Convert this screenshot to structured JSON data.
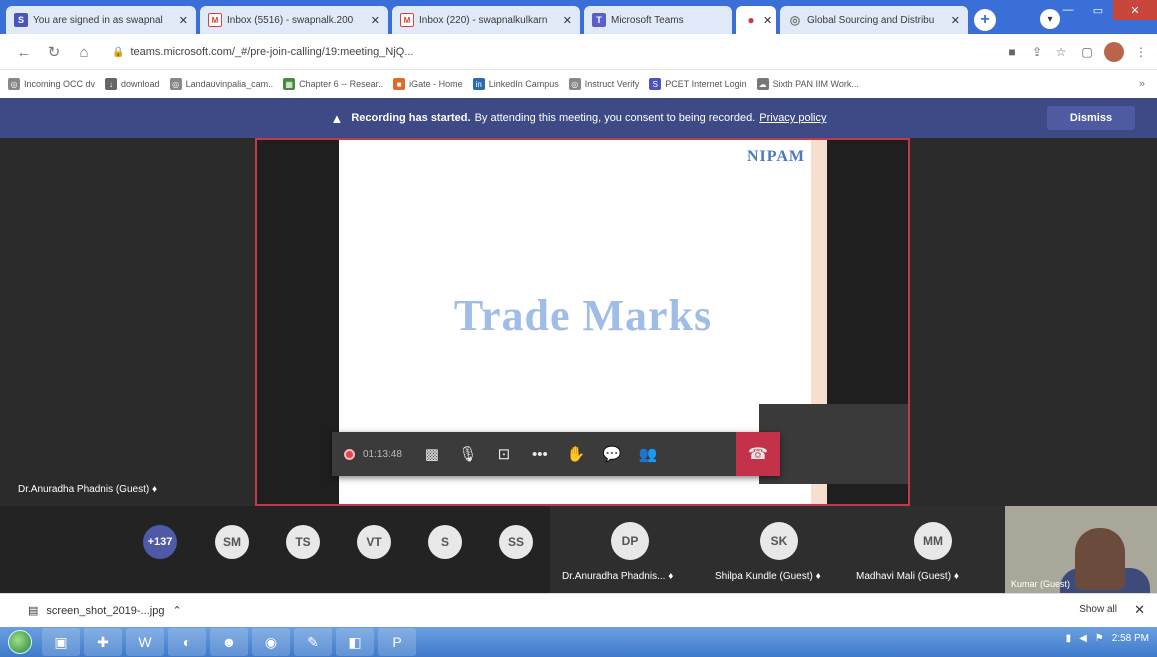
{
  "browser": {
    "tabs": [
      {
        "title": "You are signed in as swapnal",
        "favicon": "s-icon"
      },
      {
        "title": "Inbox (5516) - swapnalk.200",
        "favicon": "gmail-icon"
      },
      {
        "title": "Inbox (220) - swapnalkulkarn",
        "favicon": "gmail-icon"
      },
      {
        "title": "Microsoft Teams",
        "favicon": "teams-icon"
      },
      {
        "title": "",
        "favicon": "recording-dot-icon"
      },
      {
        "title": "Global Sourcing and Distribu",
        "favicon": "globe-icon"
      }
    ],
    "url": "teams.microsoft.com/_#/pre-join-calling/19:meeting_NjQ...",
    "bookmarks": [
      "Incoming OCC dv",
      "download",
      "Landauvinpalia_cam..",
      "Chapter 6 -- Resear..",
      "iGate - Home",
      "LinkedIn Campus",
      "Instruct Verify",
      "PCET Internet Login",
      "Sixth PAN IIM Work..."
    ],
    "bookmarks_more": "»"
  },
  "meeting": {
    "banner": {
      "bold": "Recording has started.",
      "text": "By attending this meeting, you consent to being recorded.",
      "link": "Privacy policy",
      "dismiss": "Dismiss"
    },
    "slide": {
      "logo": "NIPAM",
      "headline": "Trade Marks"
    },
    "presenter_label": "Dr.Anuradha Phadnis (Guest)",
    "timer": "01:13:48",
    "participants": [
      {
        "initials": "+137",
        "kind": "more"
      },
      {
        "initials": "SM",
        "kind": "avatar"
      },
      {
        "initials": "TS",
        "kind": "avatar"
      },
      {
        "initials": "VT",
        "kind": "avatar"
      },
      {
        "initials": "S",
        "kind": "avatar"
      },
      {
        "initials": "SS",
        "kind": "avatar"
      }
    ],
    "named_participants": [
      {
        "initials": "DP",
        "name": "Dr.Anuradha Phadnis..."
      },
      {
        "initials": "SK",
        "name": "Shilpa Kundle (Guest)"
      },
      {
        "initials": "MM",
        "name": "Madhavi Mali (Guest)"
      }
    ],
    "camera_label": "Kumar (Guest)"
  },
  "downloads": {
    "file": "screen_shot_2019-...jpg",
    "show_all": "Show all"
  },
  "taskbar": {
    "time": "2:58 PM"
  }
}
